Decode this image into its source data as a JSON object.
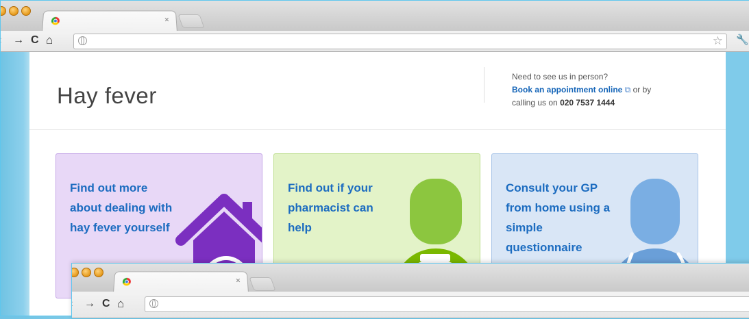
{
  "browser_back": {
    "tab_close": "×",
    "nav": {
      "back": "‹",
      "forward": "→",
      "reload": "C",
      "home": "⌂"
    },
    "bookmark_star": "☆",
    "wrench": "🔧"
  },
  "header": {
    "title": "Hay fever",
    "contact_line1": "Need to see us in person?",
    "book_link": "Book an appointment online",
    "ext_icon": "⧉",
    "or_by": "or by",
    "calling": "calling us on",
    "phone": "020 7537 1444"
  },
  "cards": [
    {
      "text": "Find out more about dealing with hay fever yourself",
      "color": "#7b2fc0"
    },
    {
      "text": "Find out if your pharmacist can help",
      "color": "#7ab800"
    },
    {
      "text": "Consult your GP from home using a simple questionnaire",
      "color": "#6a9fd8"
    }
  ],
  "browser_front": {
    "tab_close": "×",
    "nav": {
      "back": "‹",
      "forward": "→",
      "reload": "C",
      "home": "⌂"
    }
  }
}
